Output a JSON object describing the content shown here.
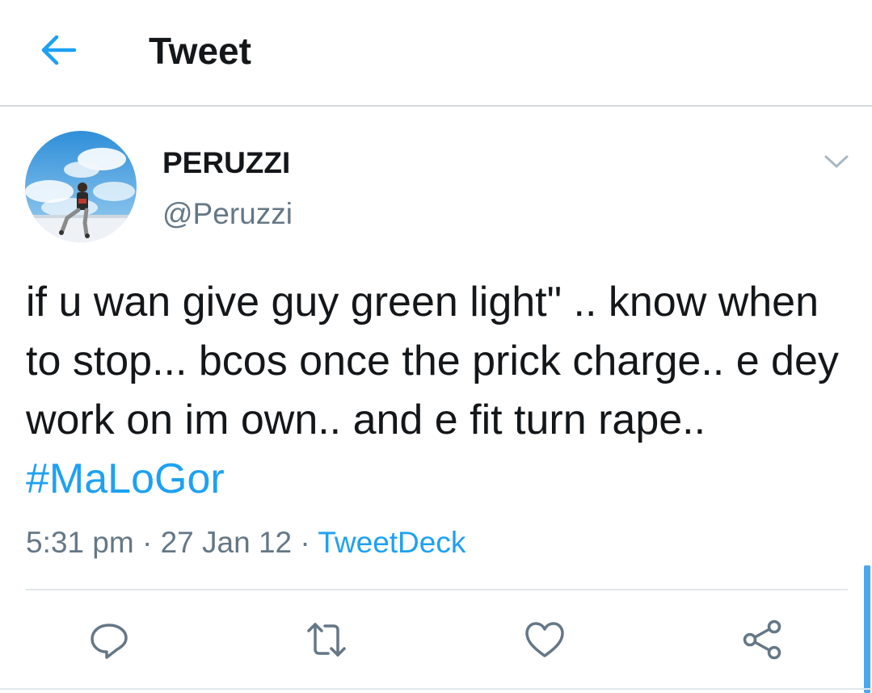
{
  "header": {
    "back_icon": "arrow-left-icon",
    "title": "Tweet"
  },
  "tweet": {
    "author": {
      "display_name": "PERUZZI",
      "handle": "@Peruzzi"
    },
    "text": "if u wan give guy green light\" .. know when to stop... bcos once the prick charge.. e dey work on im own.. and e fit turn rape..",
    "hashtag": "#MaLoGor",
    "time": "5:31 pm",
    "separator": " · ",
    "date": "27 Jan 12",
    "source": "TweetDeck"
  },
  "actions": [
    {
      "name": "reply",
      "icon": "reply-icon"
    },
    {
      "name": "retweet",
      "icon": "retweet-icon"
    },
    {
      "name": "like",
      "icon": "heart-icon"
    },
    {
      "name": "share",
      "icon": "share-icon"
    }
  ],
  "colors": {
    "accent": "#1da1f2",
    "text": "#14171a",
    "secondary": "#657786",
    "divider": "#e1e8ed",
    "icon": "#657786"
  }
}
